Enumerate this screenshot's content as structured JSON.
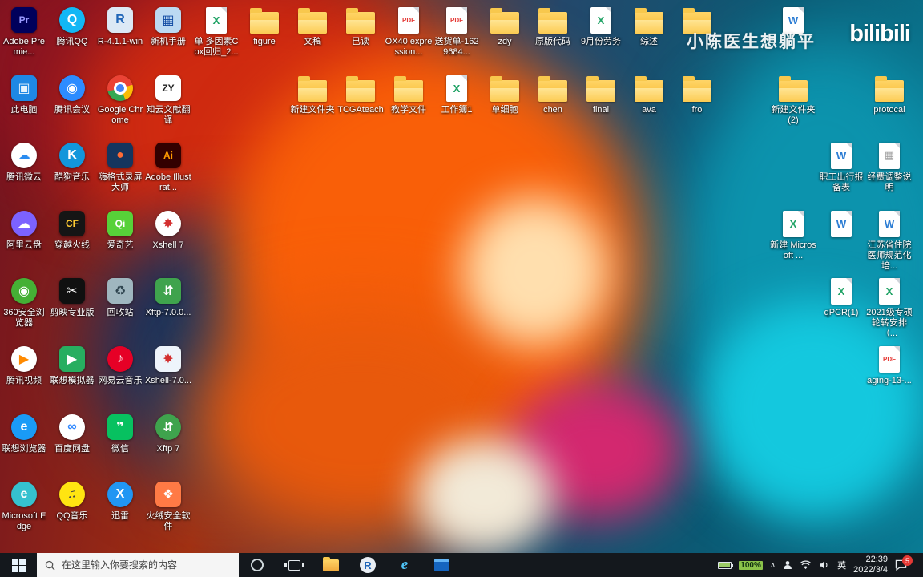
{
  "watermark": {
    "text": "小陈医生想躺平",
    "brand": "bilibili"
  },
  "desktop": {
    "icons": [
      {
        "n": "adobe-premiere",
        "l": "Adobe Premie...",
        "c": 0,
        "r": 0,
        "t": "tile",
        "bg": "#00005b",
        "fg": "#9999ff",
        "g": "Pr"
      },
      {
        "n": "this-pc",
        "l": "此电脑",
        "c": 0,
        "r": 1,
        "t": "tile",
        "bg": "#1e88e5",
        "fg": "#e3f2fd",
        "g": "▣"
      },
      {
        "n": "tencent-weiyun",
        "l": "腾讯微云",
        "c": 0,
        "r": 2,
        "t": "circle",
        "bg": "#ffffff",
        "fg": "#2a8cf0",
        "g": "☁"
      },
      {
        "n": "aliyun-drive",
        "l": "阿里云盘",
        "c": 0,
        "r": 3,
        "t": "circle",
        "bg": "#7c62ff",
        "fg": "#ffffff",
        "g": "☁"
      },
      {
        "n": "360-browser",
        "l": "360安全浏览器",
        "c": 0,
        "r": 4,
        "t": "circle",
        "bg": "#45b035",
        "fg": "#ffffff",
        "g": "◉"
      },
      {
        "n": "tencent-video",
        "l": "腾讯视频",
        "c": 0,
        "r": 5,
        "t": "circle",
        "bg": "#ffffff",
        "fg": "#ff8a00",
        "g": "▶"
      },
      {
        "n": "lenovo-browser",
        "l": "联想浏览器",
        "c": 0,
        "r": 6,
        "t": "circle",
        "bg": "#1a9bf7",
        "fg": "#ffffff",
        "g": "e"
      },
      {
        "n": "microsoft-edge",
        "l": "Microsoft Edge",
        "c": 0,
        "r": 7,
        "t": "circle",
        "bg": "#35c1cf",
        "fg": "#ffffff",
        "g": "e"
      },
      {
        "n": "tencent-qq",
        "l": "腾讯QQ",
        "c": 1,
        "r": 0,
        "t": "circle",
        "bg": "#12b7f5",
        "fg": "#ffffff",
        "g": "Q"
      },
      {
        "n": "tencent-meeting",
        "l": "腾讯会议",
        "c": 1,
        "r": 1,
        "t": "circle",
        "bg": "#2d8cff",
        "fg": "#ffffff",
        "g": "◉"
      },
      {
        "n": "kugou-music",
        "l": "酷狗音乐",
        "c": 1,
        "r": 2,
        "t": "circle",
        "bg": "#1296db",
        "fg": "#ffffff",
        "g": "K"
      },
      {
        "n": "crossfire",
        "l": "穿越火线",
        "c": 1,
        "r": 3,
        "t": "tile",
        "bg": "#151515",
        "fg": "#ffcc33",
        "g": "CF"
      },
      {
        "n": "capcut",
        "l": "剪映专业版",
        "c": 1,
        "r": 4,
        "t": "tile",
        "bg": "#101010",
        "fg": "#ffffff",
        "g": "✂"
      },
      {
        "n": "lenovo-emulator",
        "l": "联想模拟器",
        "c": 1,
        "r": 5,
        "t": "tile",
        "bg": "#27ae60",
        "fg": "#ffffff",
        "g": "▶"
      },
      {
        "n": "baidu-netdisk",
        "l": "百度网盘",
        "c": 1,
        "r": 6,
        "t": "circle",
        "bg": "#ffffff",
        "fg": "#2f88ff",
        "g": "∞"
      },
      {
        "n": "qq-music",
        "l": "QQ音乐",
        "c": 1,
        "r": 7,
        "t": "circle",
        "bg": "#ffe411",
        "fg": "#444444",
        "g": "♫"
      },
      {
        "n": "r-installer",
        "l": "R-4.1.1-win",
        "c": 2,
        "r": 0,
        "t": "tile",
        "bg": "#dce9f5",
        "fg": "#1f65b7",
        "g": "R"
      },
      {
        "n": "google-chrome",
        "l": "Google Chrome",
        "c": 2,
        "r": 1,
        "t": "circle",
        "bg": "",
        "fg": "#ffffff",
        "g": "",
        "v": "chrome"
      },
      {
        "n": "higeshi-recorder",
        "l": "嗨格式录屏大师",
        "c": 2,
        "r": 2,
        "t": "tile",
        "bg": "#15355e",
        "fg": "#ff6b35",
        "g": "●"
      },
      {
        "n": "iqiyi",
        "l": "爱奇艺",
        "c": 2,
        "r": 3,
        "t": "tile",
        "bg": "#57d139",
        "fg": "#ffffff",
        "g": "Qi"
      },
      {
        "n": "recycle-bin",
        "l": "回收站",
        "c": 2,
        "r": 4,
        "t": "tile",
        "bg": "#9fb6bf",
        "fg": "#2f4550",
        "g": "♻"
      },
      {
        "n": "netease-music",
        "l": "网易云音乐",
        "c": 2,
        "r": 5,
        "t": "circle",
        "bg": "#e60026",
        "fg": "#ffffff",
        "g": "♪"
      },
      {
        "n": "wechat",
        "l": "微信",
        "c": 2,
        "r": 6,
        "t": "tile",
        "bg": "#07c160",
        "fg": "#ffffff",
        "g": "❞"
      },
      {
        "n": "thunder",
        "l": "迅雷",
        "c": 2,
        "r": 7,
        "t": "circle",
        "bg": "#2196f3",
        "fg": "#ffffff",
        "g": "X"
      },
      {
        "n": "new-pc-manual",
        "l": "新机手册",
        "c": 3,
        "r": 0,
        "t": "tile",
        "bg": "#bcd9f2",
        "fg": "#0d47a1",
        "g": "▦"
      },
      {
        "n": "zhiyun-translate",
        "l": "知云文献翻译",
        "c": 3,
        "r": 1,
        "t": "tile",
        "bg": "#ffffff",
        "fg": "#222222",
        "g": "ZY"
      },
      {
        "n": "adobe-illustrator",
        "l": "Adobe Illustrat...",
        "c": 3,
        "r": 2,
        "t": "tile",
        "bg": "#330000",
        "fg": "#ff9a00",
        "g": "Ai"
      },
      {
        "n": "xshell7",
        "l": "Xshell 7",
        "c": 3,
        "r": 3,
        "t": "circle",
        "bg": "#ffffff",
        "fg": "#d32f2f",
        "g": "✸"
      },
      {
        "n": "xftp-setup",
        "l": "Xftp-7.0.0...",
        "c": 3,
        "r": 4,
        "t": "tile",
        "bg": "#3fa34d",
        "fg": "#ffffff",
        "g": "⇵"
      },
      {
        "n": "xshell-setup",
        "l": "Xshell-7.0...",
        "c": 3,
        "r": 5,
        "t": "tile",
        "bg": "#eef4fb",
        "fg": "#d32f2f",
        "g": "✸"
      },
      {
        "n": "xftp7",
        "l": "Xftp 7",
        "c": 3,
        "r": 6,
        "t": "circle",
        "bg": "#3fa34d",
        "fg": "#ffffff",
        "g": "⇵"
      },
      {
        "n": "huorong-security",
        "l": "火绒安全软件",
        "c": 3,
        "r": 7,
        "t": "tile",
        "bg": "#ff7a45",
        "fg": "#ffffff",
        "g": "❖"
      },
      {
        "n": "excel-cox",
        "l": "单 多因素Cox回归_2...",
        "c": 4,
        "r": 0,
        "t": "page",
        "bg": "#21a366",
        "g": "X"
      },
      {
        "n": "folder-figure",
        "l": "figure",
        "c": 5,
        "r": 0,
        "t": "folder"
      },
      {
        "n": "folder-wengao",
        "l": "文稿",
        "c": 6,
        "r": 0,
        "t": "folder"
      },
      {
        "n": "folder-xinjian",
        "l": "新建文件夹",
        "c": 6,
        "r": 1,
        "t": "folder"
      },
      {
        "n": "folder-yidu",
        "l": "已读",
        "c": 7,
        "r": 0,
        "t": "folder"
      },
      {
        "n": "folder-tcgateach",
        "l": "TCGAteach",
        "c": 7,
        "r": 1,
        "t": "folder"
      },
      {
        "n": "pdf-ox40",
        "l": "OX40 expression...",
        "c": 8,
        "r": 0,
        "t": "page",
        "bg": "#e53935",
        "g": "PDF"
      },
      {
        "n": "folder-jiaoxue",
        "l": "教学文件",
        "c": 8,
        "r": 1,
        "t": "folder"
      },
      {
        "n": "pdf-songhuodan",
        "l": "送货单-1629684...",
        "c": 9,
        "r": 0,
        "t": "page",
        "bg": "#e53935",
        "g": "PDF"
      },
      {
        "n": "excel-workbook1",
        "l": "工作簿1",
        "c": 9,
        "r": 1,
        "t": "page",
        "bg": "#21a366",
        "g": "X"
      },
      {
        "n": "folder-zdy",
        "l": "zdy",
        "c": 10,
        "r": 0,
        "t": "folder"
      },
      {
        "n": "folder-danxibao",
        "l": "单细胞",
        "c": 10,
        "r": 1,
        "t": "folder"
      },
      {
        "n": "folder-yuanban",
        "l": "原版代码",
        "c": 11,
        "r": 0,
        "t": "folder"
      },
      {
        "n": "folder-chen",
        "l": "chen",
        "c": 11,
        "r": 1,
        "t": "folder"
      },
      {
        "n": "excel-sep-labor",
        "l": "9月份劳务",
        "c": 12,
        "r": 0,
        "t": "page",
        "bg": "#21a366",
        "g": "X"
      },
      {
        "n": "folder-final",
        "l": "final",
        "c": 12,
        "r": 1,
        "t": "folder"
      },
      {
        "n": "folder-zongshu",
        "l": "综述",
        "c": 13,
        "r": 0,
        "t": "folder"
      },
      {
        "n": "folder-ava",
        "l": "ava",
        "c": 13,
        "r": 1,
        "t": "folder"
      },
      {
        "n": "folder-unnamed",
        "l": "",
        "c": 14,
        "r": 0,
        "t": "folder"
      },
      {
        "n": "folder-fro",
        "l": "fro",
        "c": 14,
        "r": 1,
        "t": "folder"
      },
      {
        "n": "doc-unnamed-top",
        "l": "",
        "c": 16,
        "r": 0,
        "t": "page",
        "bg": "#2b7cd3",
        "g": "W"
      },
      {
        "n": "folder-xinjian2",
        "l": "新建文件夹(2)",
        "c": 16,
        "r": 1,
        "t": "folder"
      },
      {
        "n": "excel-new",
        "l": "新建 Microsoft ...",
        "c": 16,
        "r": 3,
        "t": "page",
        "bg": "#21a366",
        "g": "X"
      },
      {
        "n": "doc-trip-report",
        "l": "职工出行报备表",
        "c": 17,
        "r": 2,
        "t": "page",
        "bg": "#2b7cd3",
        "g": "W"
      },
      {
        "n": "doc-unnamed",
        "l": "",
        "c": 17,
        "r": 3,
        "t": "page",
        "bg": "#2b7cd3",
        "g": "W"
      },
      {
        "n": "excel-qpcr",
        "l": "qPCR(1)",
        "c": 17,
        "r": 4,
        "t": "page",
        "bg": "#21a366",
        "g": "X"
      },
      {
        "n": "folder-protocal",
        "l": "protocal",
        "c": 18,
        "r": 1,
        "t": "folder"
      },
      {
        "n": "img-funding-note",
        "l": "经费调整说明",
        "c": 18,
        "r": 2,
        "t": "page",
        "bg": "#9e9e9e",
        "g": "▦"
      },
      {
        "n": "doc-jiangsu",
        "l": "江苏省住院医师规范化培...",
        "c": 18,
        "r": 3,
        "t": "page",
        "bg": "#2b7cd3",
        "g": "W"
      },
      {
        "n": "excel-2021",
        "l": "2021级专硕轮转安排（...",
        "c": 18,
        "r": 4,
        "t": "page",
        "bg": "#21a366",
        "g": "X"
      },
      {
        "n": "pdf-aging13",
        "l": "aging-13-...",
        "c": 18,
        "r": 5,
        "t": "page",
        "bg": "#e53935",
        "g": "PDF"
      }
    ]
  },
  "taskbar": {
    "search_placeholder": "在这里输入你要搜索的内容",
    "pinned": [
      "file-explorer",
      "r-console",
      "internet-explorer",
      "remote-window"
    ],
    "tray": {
      "battery": "100%",
      "caret": "∧",
      "lang": "英",
      "time": "22:39",
      "date": "2022/3/4",
      "badge": "5"
    }
  }
}
